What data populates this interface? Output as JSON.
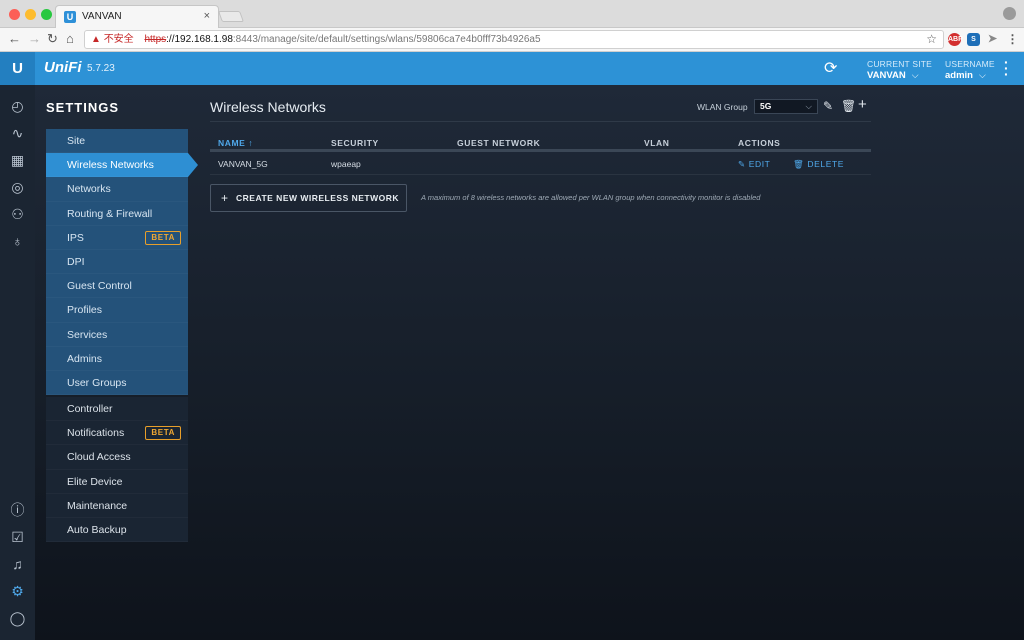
{
  "browser": {
    "tab_title": "VANVAN",
    "tab_favicon": "U",
    "tab_close": "×",
    "url_warning_icon": "▲",
    "url_insecure_label": "不安全",
    "url_scheme": "https",
    "url_host": "://192.168.1.98",
    "url_path": ":8443/manage/site/default/settings/wlans/59806ca7e4b0fff73b4926a5",
    "nav_icons": [
      "back-arrow",
      "forward-arrow",
      "reload",
      "home"
    ],
    "extensions": [
      "ABP",
      "S",
      "send",
      "menu"
    ]
  },
  "header": {
    "logo_letter": "U",
    "brand": "UniFi",
    "version": "5.7.23",
    "current_site_label": "CURRENT SITE",
    "current_site_value": "VANVAN",
    "username_label": "USERNAME",
    "username_value": "admin",
    "accent_color": "#2d92d6"
  },
  "rail_icons": [
    "dashboard-icon",
    "statistics-icon",
    "map-icon",
    "devices-icon",
    "clients-icon",
    "insights-icon",
    "info-icon",
    "tasks-icon",
    "alerts-icon",
    "settings-icon",
    "chat-icon"
  ],
  "settings": {
    "title": "SETTINGS",
    "menu_group_1": [
      {
        "label": "Site"
      },
      {
        "label": "Wireless Networks",
        "active": true
      },
      {
        "label": "Networks"
      },
      {
        "label": "Routing & Firewall"
      },
      {
        "label": "IPS",
        "badge": "BETA"
      },
      {
        "label": "DPI"
      },
      {
        "label": "Guest Control"
      },
      {
        "label": "Profiles"
      },
      {
        "label": "Services"
      },
      {
        "label": "Admins"
      },
      {
        "label": "User Groups"
      }
    ],
    "menu_group_2": [
      {
        "label": "Controller"
      },
      {
        "label": "Notifications",
        "badge": "BETA"
      },
      {
        "label": "Cloud Access"
      },
      {
        "label": "Elite Device"
      },
      {
        "label": "Maintenance"
      },
      {
        "label": "Auto Backup"
      }
    ],
    "badge_color": "#f0a733"
  },
  "main": {
    "title": "Wireless Networks",
    "wlan_group_label": "WLAN Group",
    "wlan_group_value": "5G",
    "table": {
      "columns": [
        "NAME",
        "SECURITY",
        "GUEST NETWORK",
        "VLAN",
        "ACTIONS"
      ],
      "sort_indicator": "↑",
      "rows": [
        {
          "name": "VANVAN_5G",
          "security": "wpaeap",
          "guest": "",
          "vlan": "",
          "edit": "EDIT",
          "delete": "DELETE"
        }
      ]
    },
    "create_button": "CREATE NEW WIRELESS NETWORK",
    "note": "A maximum of 8 wireless networks are allowed per WLAN group when connectivity monitor is disabled"
  }
}
